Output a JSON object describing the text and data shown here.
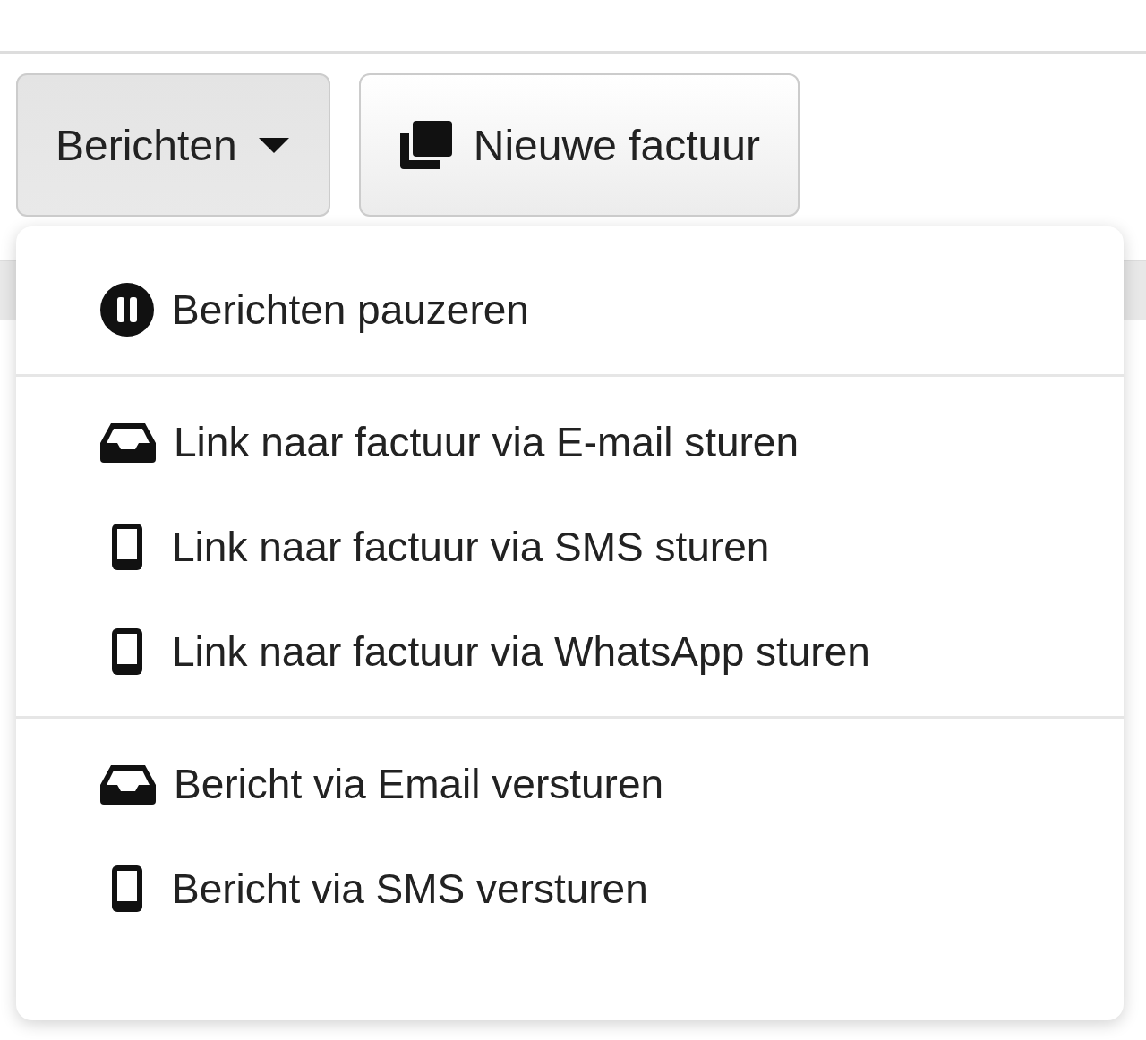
{
  "toolbar": {
    "buttons": [
      {
        "label": "Berichten",
        "kind": "dropdown",
        "expanded": true
      },
      {
        "label": "Nieuwe factuur",
        "kind": "copy",
        "expanded": false
      }
    ]
  },
  "menu": {
    "groups": [
      [
        {
          "label": "Berichten pauzeren",
          "kind": "pause"
        }
      ],
      [
        {
          "label": "Link naar factuur via E-mail sturen",
          "kind": "inbox"
        },
        {
          "label": "Link naar factuur via SMS sturen",
          "kind": "mobile"
        },
        {
          "label": "Link naar factuur via WhatsApp sturen",
          "kind": "mobile"
        }
      ],
      [
        {
          "label": "Bericht via Email versturen",
          "kind": "inbox"
        },
        {
          "label": "Bericht via SMS versturen",
          "kind": "mobile"
        }
      ]
    ]
  }
}
